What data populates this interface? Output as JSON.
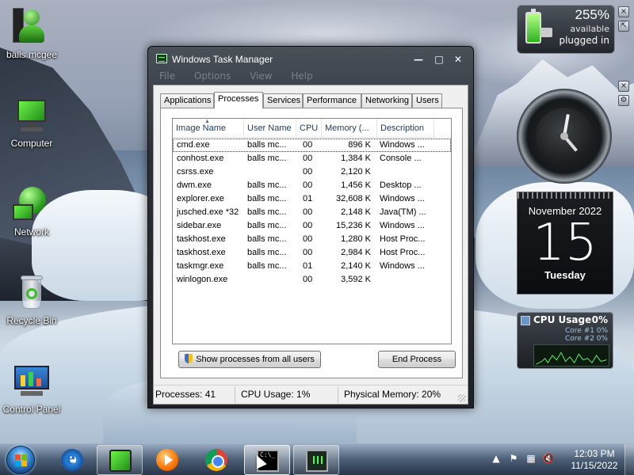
{
  "desktop": {
    "icons": [
      {
        "label": "balls mcgee",
        "icon": "user-folder-icon"
      },
      {
        "label": "Computer",
        "icon": "computer-icon"
      },
      {
        "label": "Network",
        "icon": "network-icon"
      },
      {
        "label": "Recycle Bin",
        "icon": "recycle-bin-icon"
      },
      {
        "label": "Control Panel",
        "icon": "control-panel-icon"
      }
    ]
  },
  "gadgets": {
    "battery": {
      "percent": "255%",
      "status1": "available",
      "status2": "plugged in"
    },
    "calendar": {
      "month": "November 2022",
      "day": "15",
      "weekday": "Tuesday"
    },
    "cpu": {
      "title": "CPU Usage",
      "total": "0%",
      "core1_label": "Core #1",
      "core1_value": "0%",
      "core2_label": "Core #2",
      "core2_value": "0%"
    }
  },
  "window": {
    "title": "Windows Task Manager",
    "menu": [
      "File",
      "Options",
      "View",
      "Help"
    ],
    "tabs": [
      "Applications",
      "Processes",
      "Services",
      "Performance",
      "Networking",
      "Users"
    ],
    "active_tab": "Processes",
    "columns": {
      "name": "Image Name",
      "user": "User Name",
      "cpu": "CPU",
      "memory": "Memory (...",
      "description": "Description"
    },
    "processes": [
      {
        "name": "cmd.exe",
        "user": "balls mc...",
        "cpu": "00",
        "memory": "896 K",
        "description": "Windows ..."
      },
      {
        "name": "conhost.exe",
        "user": "balls mc...",
        "cpu": "00",
        "memory": "1,384 K",
        "description": "Console ..."
      },
      {
        "name": "csrss.exe",
        "user": "",
        "cpu": "00",
        "memory": "2,120 K",
        "description": ""
      },
      {
        "name": "dwm.exe",
        "user": "balls mc...",
        "cpu": "00",
        "memory": "1,456 K",
        "description": "Desktop ..."
      },
      {
        "name": "explorer.exe",
        "user": "balls mc...",
        "cpu": "01",
        "memory": "32,608 K",
        "description": "Windows ..."
      },
      {
        "name": "jusched.exe *32",
        "user": "balls mc...",
        "cpu": "00",
        "memory": "2,148 K",
        "description": "Java(TM) ..."
      },
      {
        "name": "sidebar.exe",
        "user": "balls mc...",
        "cpu": "00",
        "memory": "15,236 K",
        "description": "Windows ..."
      },
      {
        "name": "taskhost.exe",
        "user": "balls mc...",
        "cpu": "00",
        "memory": "1,280 K",
        "description": "Host Proc..."
      },
      {
        "name": "taskhost.exe",
        "user": "balls mc...",
        "cpu": "00",
        "memory": "2,984 K",
        "description": "Host Proc..."
      },
      {
        "name": "taskmgr.exe",
        "user": "balls mc...",
        "cpu": "01",
        "memory": "2,140 K",
        "description": "Windows ..."
      },
      {
        "name": "winlogon.exe",
        "user": "",
        "cpu": "00",
        "memory": "3,592 K",
        "description": ""
      }
    ],
    "buttons": {
      "show_all": "Show processes from all users",
      "end_process": "End Process"
    },
    "status": {
      "processes": "Processes: 41",
      "cpu": "CPU Usage: 1%",
      "memory": "Physical Memory: 20%"
    }
  },
  "taskbar": {
    "items": [
      "internet-explorer-icon",
      "green-app-icon",
      "media-player-icon",
      "chrome-icon",
      "cmd-icon",
      "task-manager-icon"
    ],
    "cmd_glyph": "C:\\_",
    "clock_time": "12:03 PM",
    "clock_date": "11/15/2022"
  }
}
